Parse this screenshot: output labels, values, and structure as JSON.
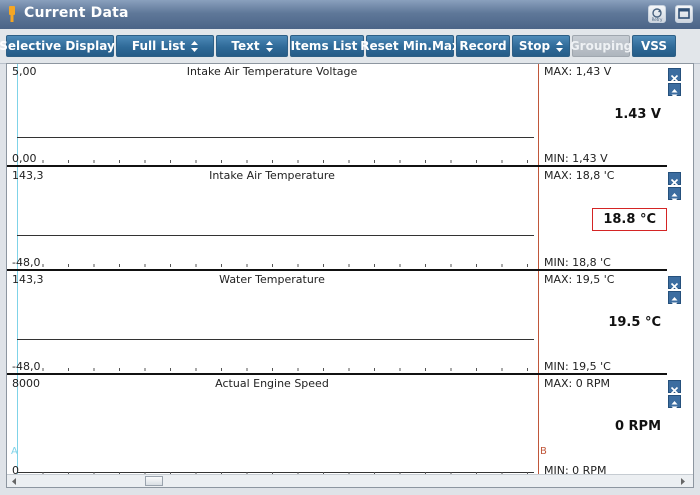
{
  "window": {
    "title": "Current Data",
    "retry_label": "Retry"
  },
  "toolbar": {
    "selective_display": "Selective Display",
    "full_list": "Full List",
    "text": "Text",
    "items_list": "Items List",
    "reset": "Reset Min.Max",
    "record": "Record",
    "stop": "Stop",
    "grouping": "Grouping",
    "vss": "VSS"
  },
  "graphs": [
    {
      "title": "Intake Air Temperature Voltage",
      "ymax": "5,00",
      "ymin": "0,00",
      "max_label": "MAX:  1,43 V",
      "min_label": "MIN:  1,43 V",
      "value": "1.43 V",
      "level": 0.286
    },
    {
      "title": "Intake Air Temperature",
      "ymax": "143,3",
      "ymin": "-48,0",
      "max_label": "MAX:  18,8 'C",
      "min_label": "MIN:  18,8 'C",
      "value": "18.8 °C",
      "level": 0.349
    },
    {
      "title": "Water Temperature",
      "ymax": "143,3",
      "ymin": "-48,0",
      "max_label": "MAX:  19,5 'C",
      "min_label": "MIN:  19,5 'C",
      "value": "19.5 °C",
      "level": 0.353
    },
    {
      "title": "Actual Engine Speed",
      "ymax": "8000",
      "ymin": "0",
      "max_label": "MAX:     0 RPM",
      "min_label": "MIN:     0 RPM",
      "value": "0 RPM",
      "level": 0
    }
  ],
  "cursors": {
    "a": "A",
    "b": "B"
  },
  "colors": {
    "title_bar": "#5f7899",
    "button": "#2f6a98",
    "cursor_a": "#7fd3e8",
    "cursor_b": "#c0573a",
    "highlight": "#d42424"
  }
}
